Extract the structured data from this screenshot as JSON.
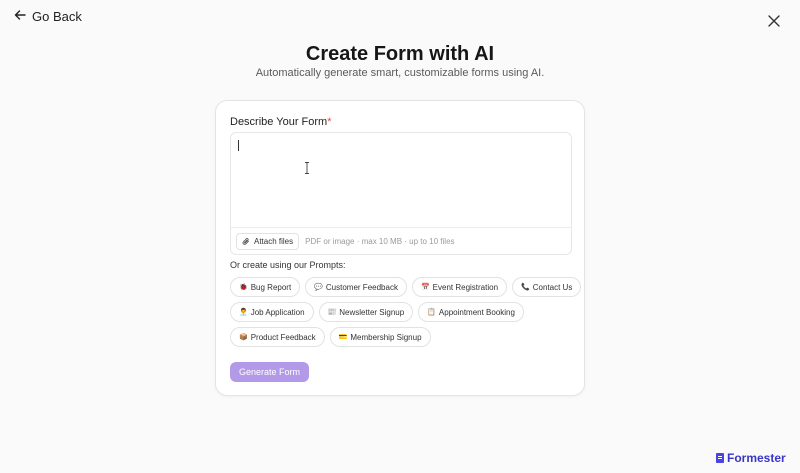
{
  "nav": {
    "back_label": "Go Back"
  },
  "header": {
    "title": "Create Form with AI",
    "subtitle": "Automatically generate smart, customizable forms using AI."
  },
  "form": {
    "label": "Describe Your Form",
    "required_mark": "*",
    "input_value": "",
    "attach_label": "Attach files",
    "attach_hint": "PDF or image · max 10 MB · up to 10 files"
  },
  "prompts": {
    "label": "Or create using our Prompts:",
    "rows": [
      [
        {
          "emoji": "🐞",
          "label": "Bug Report"
        },
        {
          "emoji": "💬",
          "label": "Customer Feedback"
        },
        {
          "emoji": "📅",
          "label": "Event Registration"
        },
        {
          "emoji": "📞",
          "label": "Contact Us"
        }
      ],
      [
        {
          "emoji": "👨‍💼",
          "label": "Job Application"
        },
        {
          "emoji": "📰",
          "label": "Newsletter Signup"
        },
        {
          "emoji": "📋",
          "label": "Appointment Booking"
        }
      ],
      [
        {
          "emoji": "📦",
          "label": "Product Feedback"
        },
        {
          "emoji": "💳",
          "label": "Membership Signup"
        }
      ]
    ]
  },
  "actions": {
    "generate_label": "Generate Form"
  },
  "brand": {
    "name": "Formester",
    "color": "#3b35c9"
  },
  "colors": {
    "accent": "#b39ae8",
    "required": "#e5484d"
  }
}
